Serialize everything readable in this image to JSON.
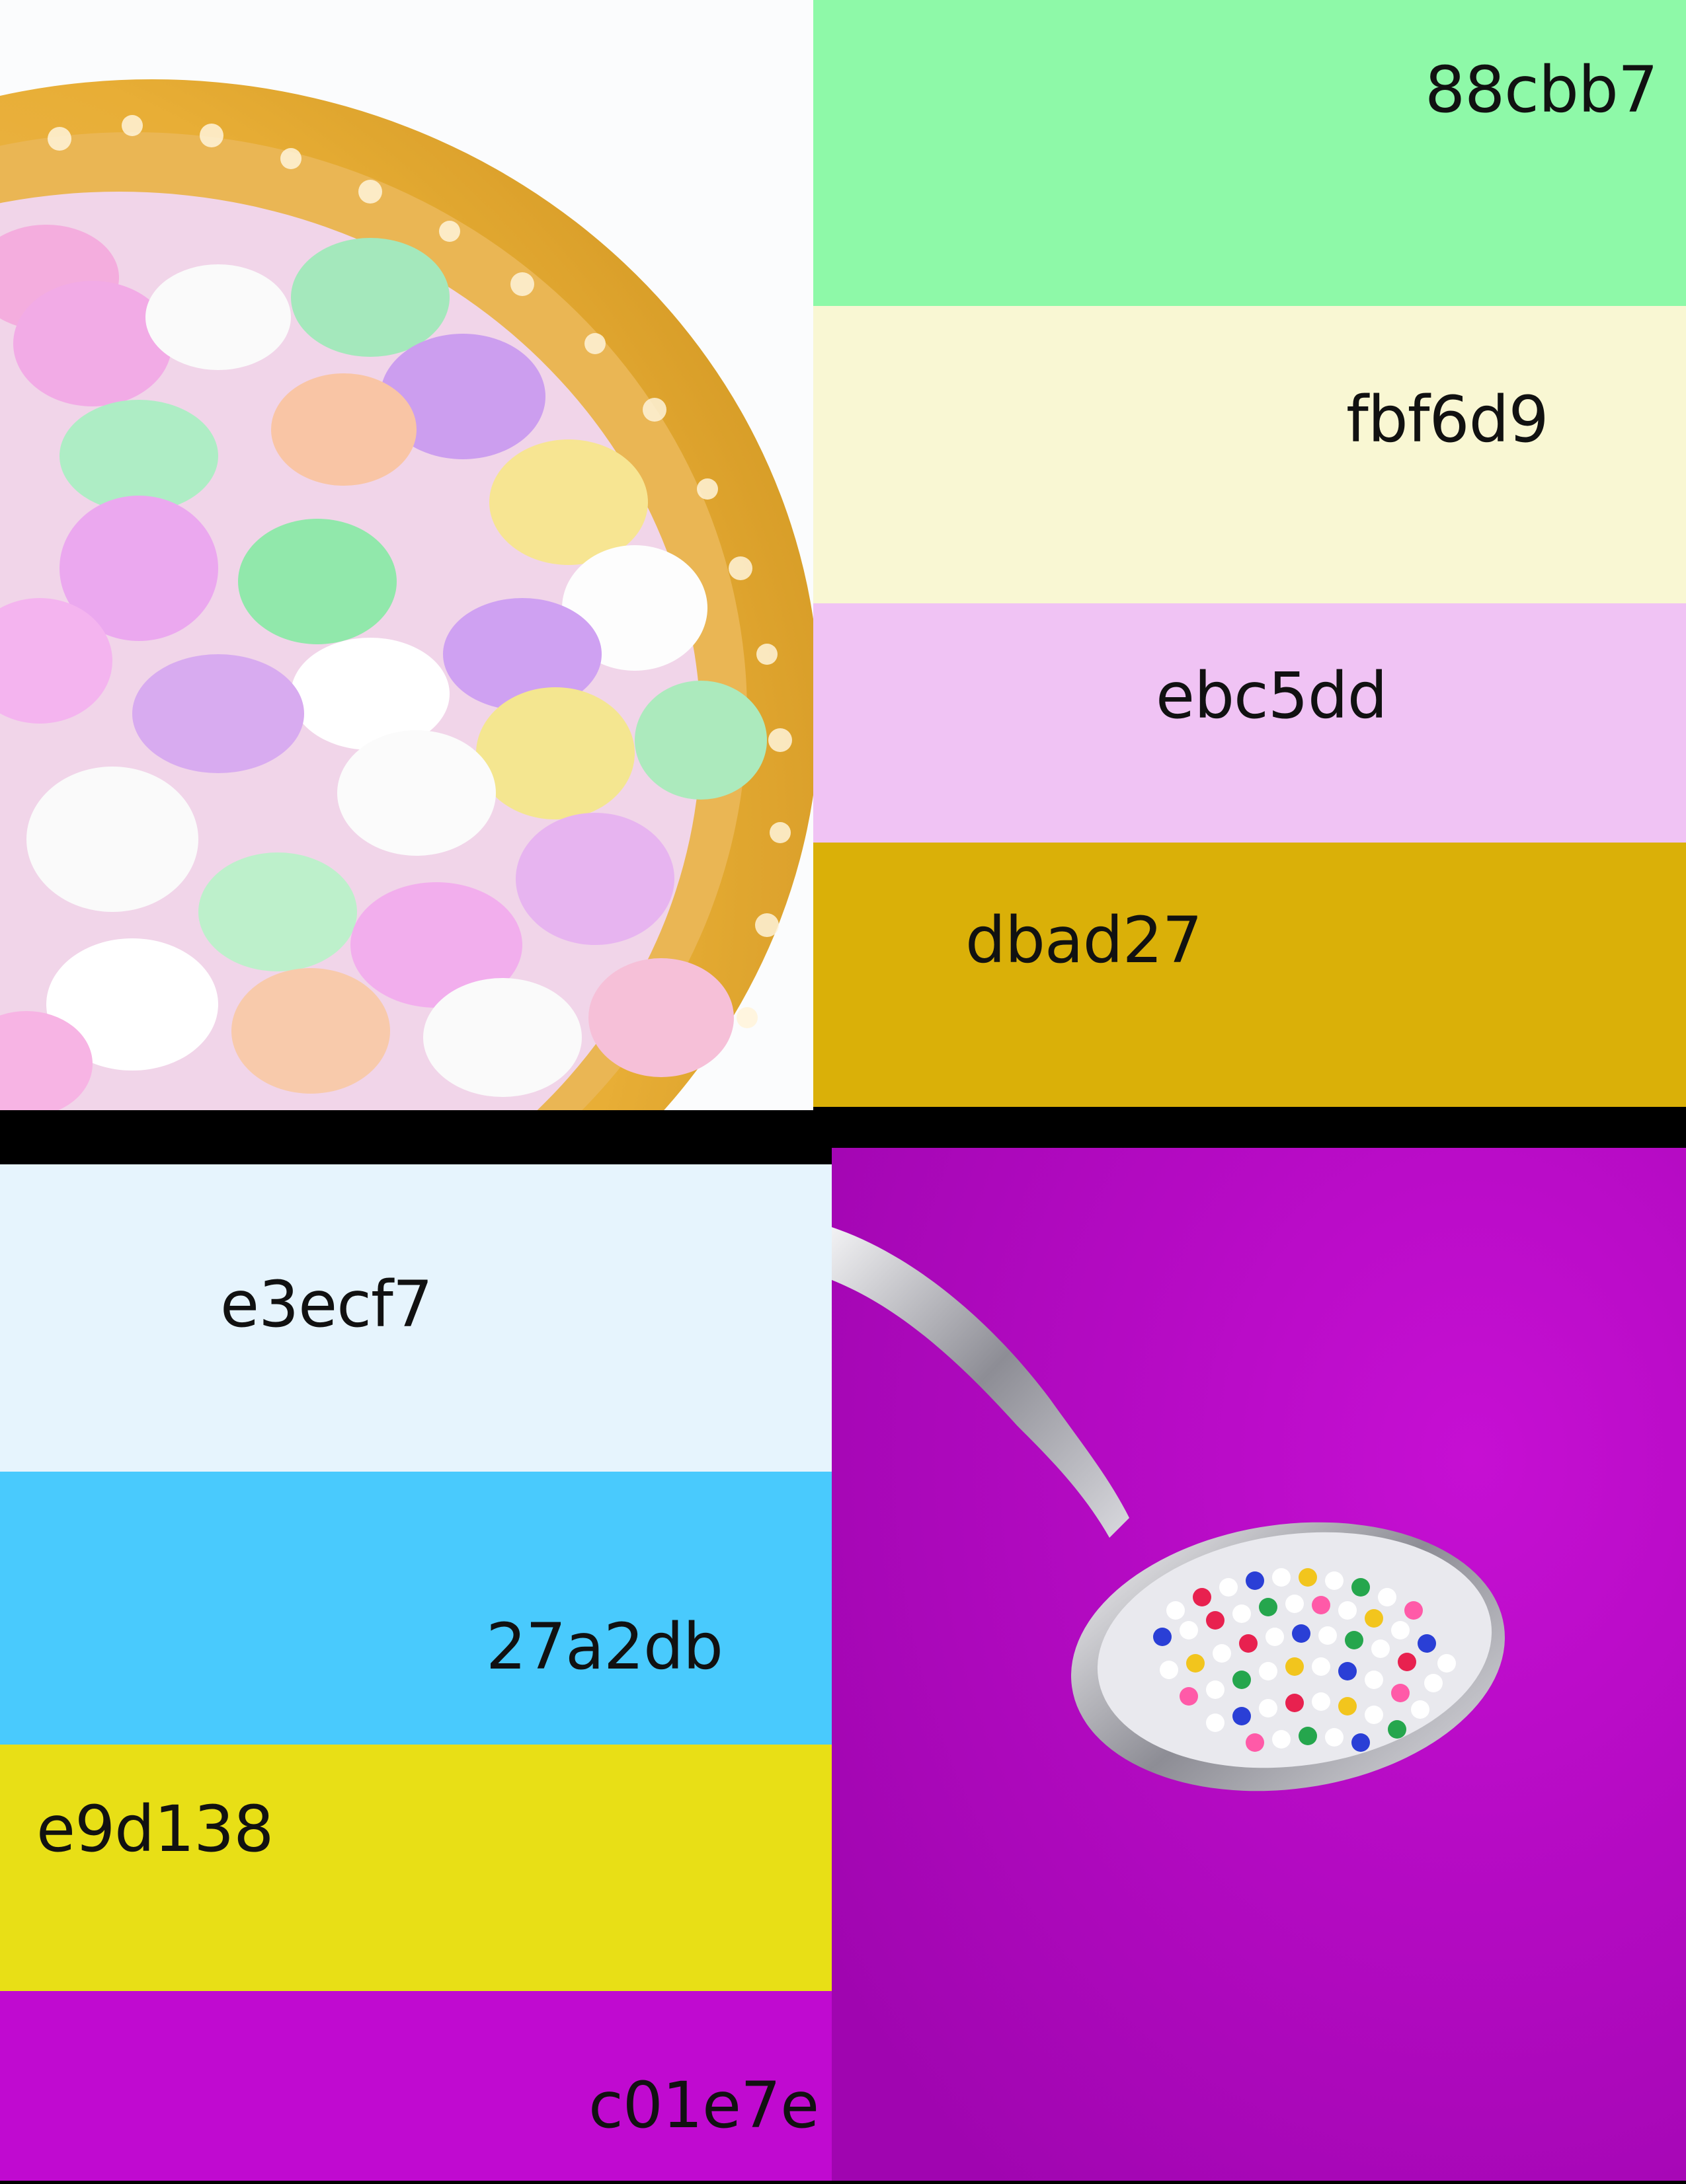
{
  "top_palette": {
    "swatches": [
      {
        "label": "88cbb7",
        "color": "#8ef9a8"
      },
      {
        "label": "fbf6d9",
        "color": "#f9f7d3"
      },
      {
        "label": "ebc5dd",
        "color": "#f0c3f4"
      },
      {
        "label": "dbad27",
        "color": "#dab008"
      }
    ]
  },
  "bottom_palette": {
    "swatches": [
      {
        "label": "e3ecf7",
        "color": "#e6f4fd"
      },
      {
        "label": "27a2db",
        "color": "#49cafd"
      },
      {
        "label": "e9d138",
        "color": "#e8df16"
      },
      {
        "label": "c01e7e",
        "color": "#c00ad0"
      }
    ]
  },
  "photos": {
    "top": {
      "subject": "bowl of candy hearts"
    },
    "bottom": {
      "subject": "spoon of nonpareil sprinkles",
      "background_color": "#b406c4"
    }
  }
}
